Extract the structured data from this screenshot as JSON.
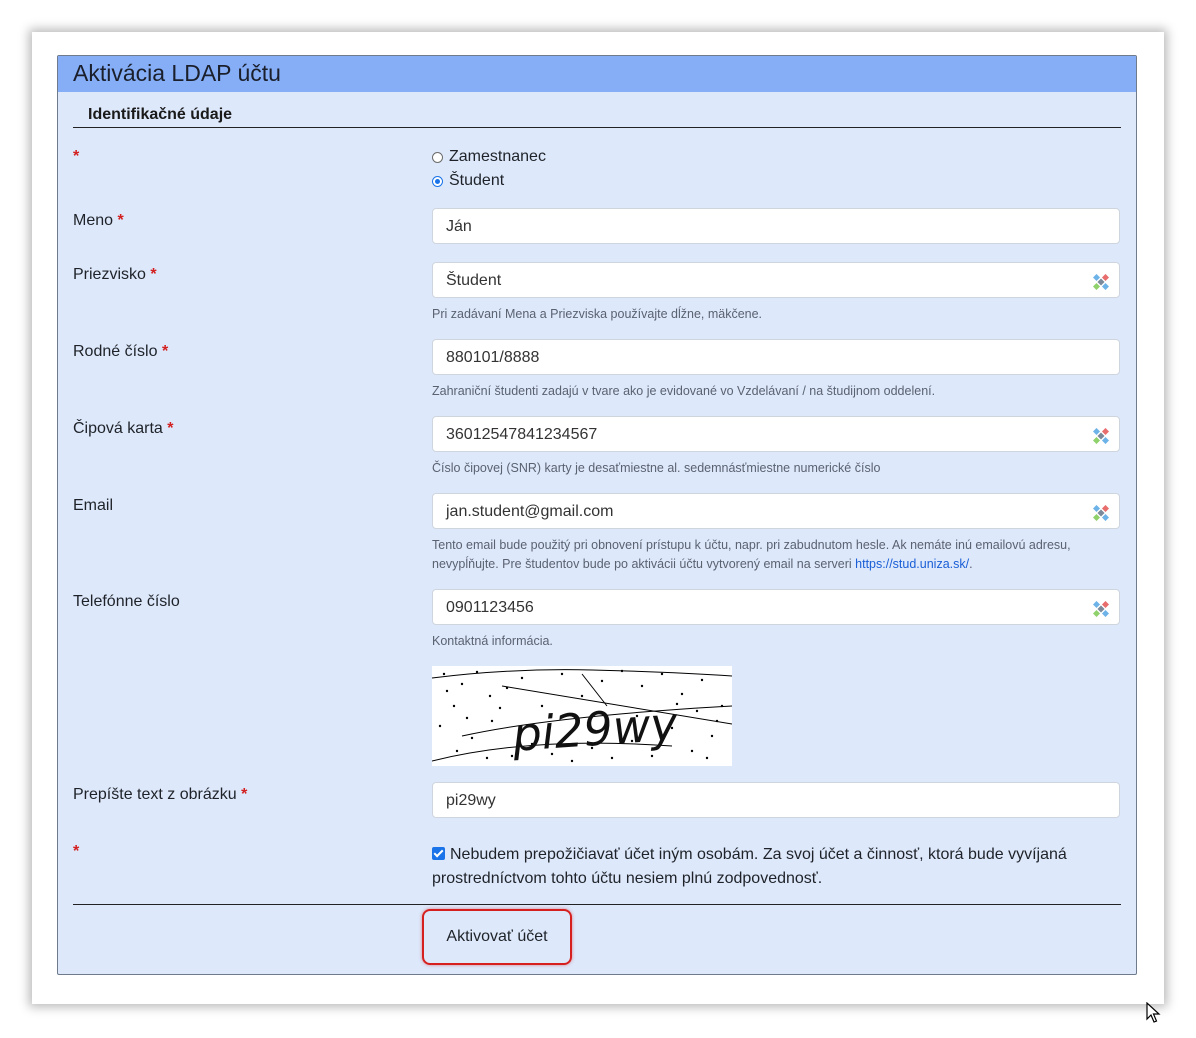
{
  "panel": {
    "title": "Aktivácia LDAP účtu",
    "section_title": "Identifikačné údaje"
  },
  "required_mark": "*",
  "account_type": {
    "options": [
      "Zamestnanec",
      "Študent"
    ],
    "selected": "Študent"
  },
  "fields": {
    "meno": {
      "label": "Meno",
      "value": "Ján"
    },
    "priezvisko": {
      "label": "Priezvisko",
      "value": "Študent",
      "help": "Pri zadávaní Mena a Priezviska používajte dĺžne, mäkčene."
    },
    "rodne_cislo": {
      "label": "Rodné číslo",
      "value": "880101/8888",
      "help": "Zahraniční študenti zadajú v tvare ako je evidované vo Vzdelávaní / na študijnom oddelení."
    },
    "cipova_karta": {
      "label": "Čipová karta",
      "value": "36012547841234567",
      "help": "Číslo čipovej (SNR) karty je desaťmiestne al. sedemnásťmiestne numerické číslo"
    },
    "email": {
      "label": "Email",
      "value": "jan.student@gmail.com",
      "help": "Tento email bude použitý pri obnovení prístupu k účtu, napr. pri zabudnutom hesle. Ak nemáte inú emailovú adresu, nevypĺňujte. Pre študentov bude po aktivácii účtu vytvorený email na serveri",
      "help_link": "https://stud.uniza.sk/",
      "help_end": "."
    },
    "telefon": {
      "label": "Telefónne číslo",
      "value": "0901123456",
      "help": "Kontaktná informácia."
    },
    "captcha": {
      "label": "Prepíšte text z obrázku",
      "image_text": "pi29wy",
      "value": "pi29wy"
    }
  },
  "agreement": {
    "checked": true,
    "text": "Nebudem prepožičiavať účet iným osobám. Za svoj účet a činnosť, ktorá bude vyvíjaná prostredníctvom tohto účtu nesiem plnú zodpovednosť."
  },
  "submit_label": "Aktivovať účet",
  "colors": {
    "header": "#85aef7",
    "panel_bg": "#dde8fb",
    "required": "#d32020",
    "highlight": "#d62020",
    "link": "#1a5fd6"
  }
}
